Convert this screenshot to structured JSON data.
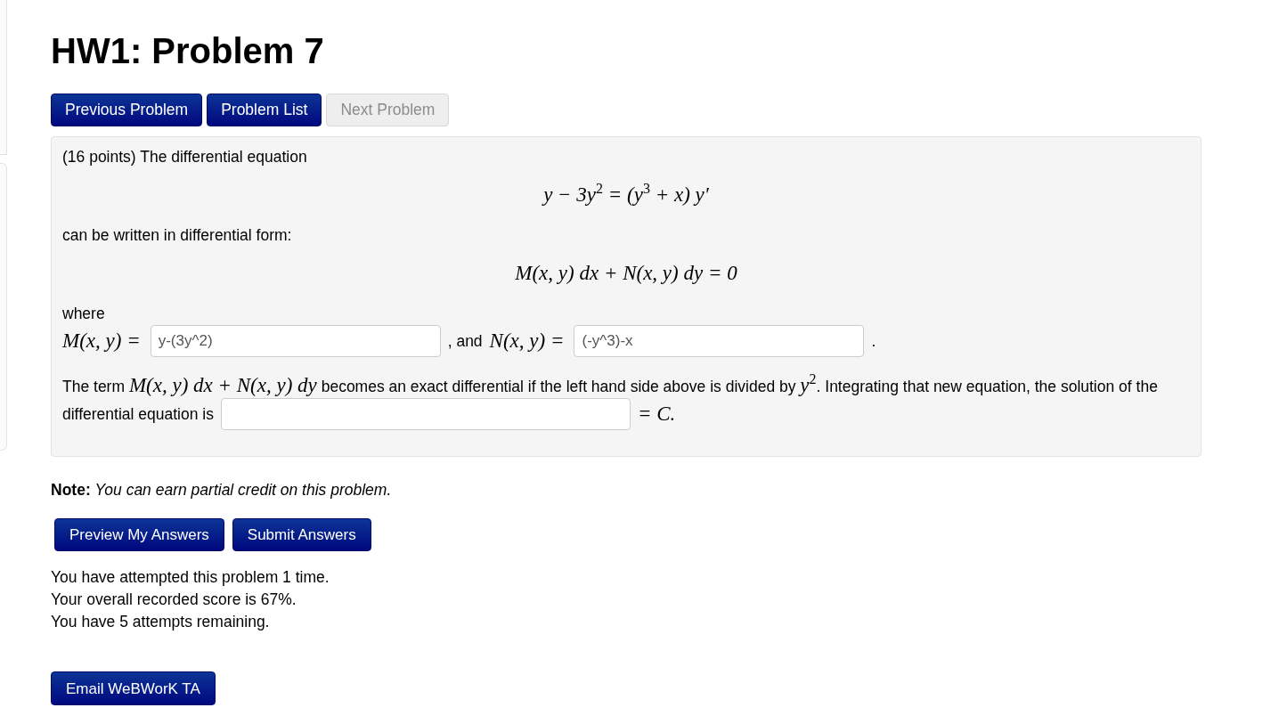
{
  "page": {
    "title": "HW1: Problem 7"
  },
  "nav_buttons": [
    {
      "label": "Previous Problem",
      "disabled": false
    },
    {
      "label": "Problem List",
      "disabled": false
    },
    {
      "label": "Next Problem",
      "disabled": true
    }
  ],
  "problem": {
    "rows": [
      {
        "kind": "text",
        "text": "(16 points) The differential equation"
      },
      {
        "kind": "equation",
        "math": "y − 3y$^{2}$ = (y$^{3}$ + x) y′"
      },
      {
        "kind": "text",
        "text": "can be written in differential form:"
      },
      {
        "kind": "equation",
        "math": "M(x, y) dx + N(x, y) dy = 0"
      },
      {
        "kind": "text",
        "text": "where"
      },
      {
        "kind": "fields",
        "parts": [
          {
            "kind": "math",
            "math": "M(x, y) ="
          },
          {
            "kind": "input",
            "value": "y-(3y^2)"
          },
          {
            "kind": "text",
            "text": ", and"
          },
          {
            "kind": "math",
            "math": "N(x, y) ="
          },
          {
            "kind": "input",
            "value": "(-y^3)-x"
          },
          {
            "kind": "text",
            "text": "."
          }
        ]
      },
      {
        "kind": "text",
        "text": "The term *M(x, y) dx + N(x, y) dy* becomes an exact differential if the left hand side above is divided by *y*$^{2}$. Integrating that new equation, the solution of the"
      },
      {
        "kind": "fields",
        "parts": [
          {
            "kind": "text",
            "text": "differential equation is"
          },
          {
            "kind": "input"
          },
          {
            "kind": "math",
            "math": "= C."
          }
        ]
      }
    ]
  },
  "note": "**Note:** *You can earn partial credit on this problem.*",
  "answer_buttons": [
    "Preview My Answers",
    "Submit Answers"
  ],
  "attempt_info": [
    "You have attempted this problem 1 time.",
    "Your overall recorded score is 67%.",
    "You have 5 attempts remaining."
  ],
  "email_button": "Email WeBWorK TA"
}
